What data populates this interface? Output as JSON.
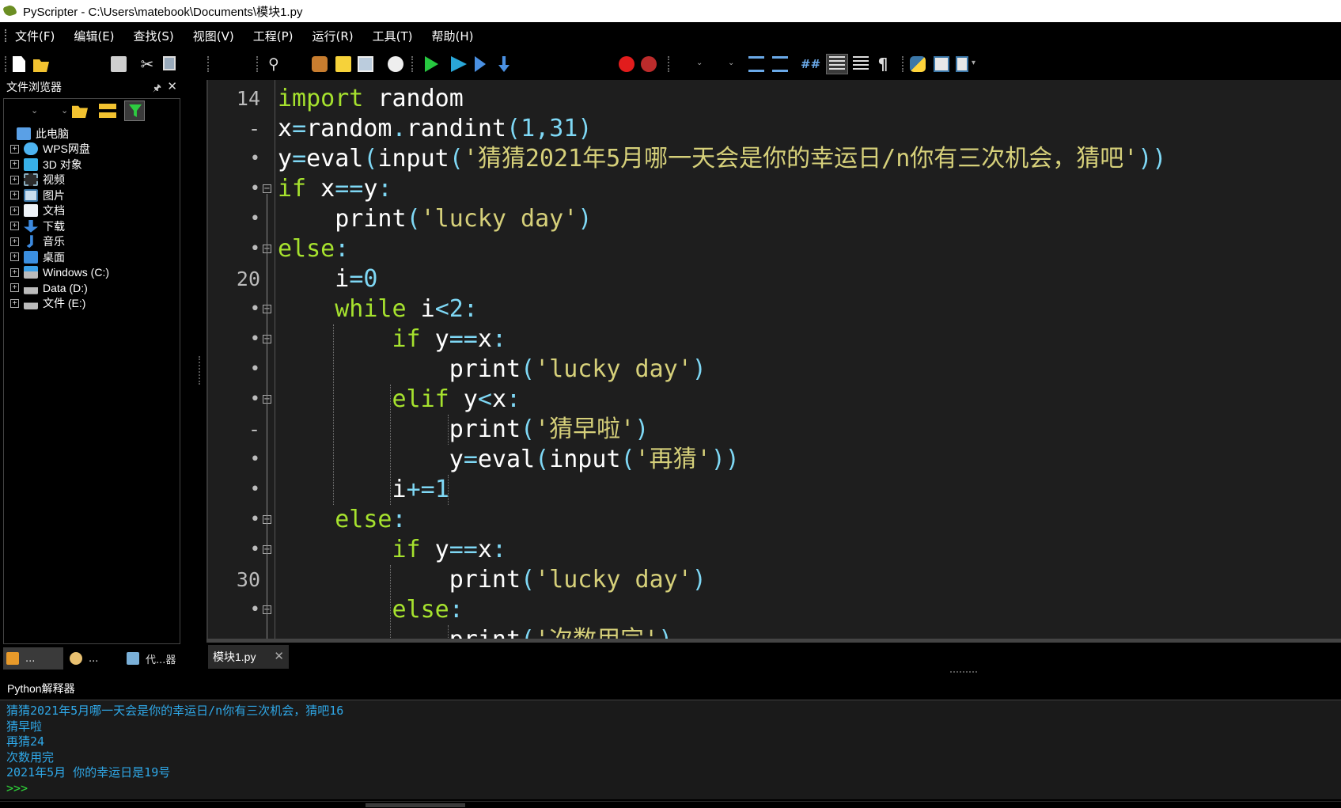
{
  "window": {
    "title": "PyScripter - C:\\Users\\matebook\\Documents\\模块1.py"
  },
  "menu": [
    "文件(F)",
    "编辑(E)",
    "查找(S)",
    "视图(V)",
    "工程(P)",
    "运行(R)",
    "工具(T)",
    "帮助(H)"
  ],
  "file_browser": {
    "title": "文件浏览器",
    "root": "此电脑",
    "items": [
      {
        "label": "WPS网盘",
        "icon": "cloud-icon"
      },
      {
        "label": "3D 对象",
        "icon": "cube-icon"
      },
      {
        "label": "视频",
        "icon": "video-icon"
      },
      {
        "label": "图片",
        "icon": "image-icon"
      },
      {
        "label": "文档",
        "icon": "document-icon"
      },
      {
        "label": "下载",
        "icon": "download-icon"
      },
      {
        "label": "音乐",
        "icon": "music-icon"
      },
      {
        "label": "桌面",
        "icon": "desktop-icon"
      },
      {
        "label": "Windows (C:)",
        "icon": "drive-icon"
      },
      {
        "label": "Data (D:)",
        "icon": "drive-icon"
      },
      {
        "label": "文件 (E:)",
        "icon": "drive-icon"
      }
    ],
    "tabs": [
      "...",
      "...",
      "代...器"
    ]
  },
  "editor": {
    "tab_label": "模块1.py",
    "lines": [
      {
        "n": "14",
        "code": [
          [
            "kw",
            "import"
          ],
          [
            "",
            " random"
          ]
        ]
      },
      {
        "n": "-",
        "code": [
          [
            "",
            "x"
          ],
          [
            "op",
            "="
          ],
          [
            "",
            "random"
          ],
          [
            "op",
            "."
          ],
          [
            "",
            "randint"
          ],
          [
            "op",
            "("
          ],
          [
            "num",
            "1"
          ],
          [
            "op",
            ","
          ],
          [
            "num",
            "31"
          ],
          [
            "op",
            ")"
          ]
        ]
      },
      {
        "n": "•",
        "code": [
          [
            "",
            "y"
          ],
          [
            "op",
            "="
          ],
          [
            "",
            "eval"
          ],
          [
            "op",
            "("
          ],
          [
            "",
            "input"
          ],
          [
            "op",
            "("
          ],
          [
            "str",
            "'猜猜2021年5月哪一天会是你的幸运日/n你有三次机会，猜吧'"
          ],
          [
            "op",
            "))"
          ]
        ]
      },
      {
        "n": "•",
        "fold": true,
        "code": [
          [
            "kw",
            "if"
          ],
          [
            "",
            " x"
          ],
          [
            "op",
            "=="
          ],
          [
            "",
            "y"
          ],
          [
            "op",
            ":"
          ]
        ]
      },
      {
        "n": "•",
        "code": [
          [
            "",
            "    print"
          ],
          [
            "op",
            "("
          ],
          [
            "str",
            "'lucky day'"
          ],
          [
            "op",
            ")"
          ]
        ]
      },
      {
        "n": "•",
        "fold": true,
        "code": [
          [
            "kw",
            "else"
          ],
          [
            "op",
            ":"
          ]
        ]
      },
      {
        "n": "20",
        "code": [
          [
            "",
            "    i"
          ],
          [
            "op",
            "="
          ],
          [
            "num",
            "0"
          ]
        ]
      },
      {
        "n": "•",
        "fold": true,
        "code": [
          [
            "kw",
            "    while"
          ],
          [
            "",
            " i"
          ],
          [
            "op",
            "<"
          ],
          [
            "num",
            "2"
          ],
          [
            "op",
            ":"
          ]
        ]
      },
      {
        "n": "•",
        "fold": true,
        "code": [
          [
            "kw",
            "        if"
          ],
          [
            "",
            " y"
          ],
          [
            "op",
            "=="
          ],
          [
            "",
            "x"
          ],
          [
            "op",
            ":"
          ]
        ]
      },
      {
        "n": "•",
        "code": [
          [
            "",
            "            print"
          ],
          [
            "op",
            "("
          ],
          [
            "str",
            "'lucky day'"
          ],
          [
            "op",
            ")"
          ]
        ]
      },
      {
        "n": "•",
        "fold": true,
        "code": [
          [
            "kw",
            "        elif"
          ],
          [
            "",
            " y"
          ],
          [
            "op",
            "<"
          ],
          [
            "",
            "x"
          ],
          [
            "op",
            ":"
          ]
        ]
      },
      {
        "n": "-",
        "code": [
          [
            "",
            "            print"
          ],
          [
            "op",
            "("
          ],
          [
            "str",
            "'猜早啦'"
          ],
          [
            "op",
            ")"
          ]
        ]
      },
      {
        "n": "•",
        "code": [
          [
            "",
            "            y"
          ],
          [
            "op",
            "="
          ],
          [
            "",
            "eval"
          ],
          [
            "op",
            "("
          ],
          [
            "",
            "input"
          ],
          [
            "op",
            "("
          ],
          [
            "str",
            "'再猜'"
          ],
          [
            "op",
            "))"
          ]
        ]
      },
      {
        "n": "•",
        "code": [
          [
            "",
            "        i"
          ],
          [
            "op",
            "+="
          ],
          [
            "num",
            "1"
          ]
        ]
      },
      {
        "n": "•",
        "fold": true,
        "code": [
          [
            "kw",
            "    else"
          ],
          [
            "op",
            ":"
          ]
        ]
      },
      {
        "n": "•",
        "fold": true,
        "code": [
          [
            "kw",
            "        if"
          ],
          [
            "",
            " y"
          ],
          [
            "op",
            "=="
          ],
          [
            "",
            "x"
          ],
          [
            "op",
            ":"
          ]
        ]
      },
      {
        "n": "30",
        "code": [
          [
            "",
            "            print"
          ],
          [
            "op",
            "("
          ],
          [
            "str",
            "'lucky day'"
          ],
          [
            "op",
            ")"
          ]
        ]
      },
      {
        "n": "•",
        "fold": true,
        "code": [
          [
            "kw",
            "        else"
          ],
          [
            "op",
            ":"
          ]
        ]
      },
      {
        "n": "-",
        "code": [
          [
            "",
            "            print"
          ],
          [
            "op",
            "("
          ],
          [
            "str",
            "'次数用完'"
          ],
          [
            "op",
            ")"
          ]
        ]
      }
    ]
  },
  "interpreter": {
    "title": "Python解释器",
    "output": [
      "猜猜2021年5月哪一天会是你的幸运日/n你有三次机会，猜吧16",
      "猜早啦",
      "再猜24",
      "次数用完",
      "2021年5月 你的幸运日是19号"
    ],
    "prompt": ">>>"
  },
  "colors": {
    "keyword": "#a6e22e",
    "string": "#d6d07a",
    "number": "#7fd8f5",
    "output": "#2fa8e8",
    "prompt": "#2fdc3a"
  }
}
